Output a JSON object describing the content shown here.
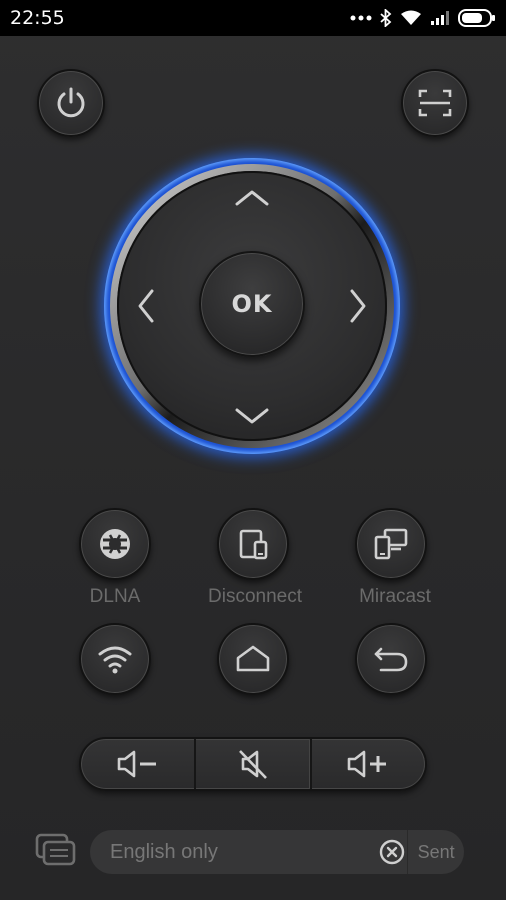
{
  "status_bar": {
    "time": "22:55"
  },
  "dpad": {
    "ok_label": "OK"
  },
  "actions": [
    {
      "label": "DLNA",
      "icon": "dlna-icon"
    },
    {
      "label": "Disconnect",
      "icon": "disconnect-icon"
    },
    {
      "label": "Miracast",
      "icon": "miracast-icon"
    }
  ],
  "input": {
    "placeholder": "English only",
    "send_label": "Sent"
  },
  "colors": {
    "glow": "#2a6bff",
    "background": "#2c2c2d"
  }
}
